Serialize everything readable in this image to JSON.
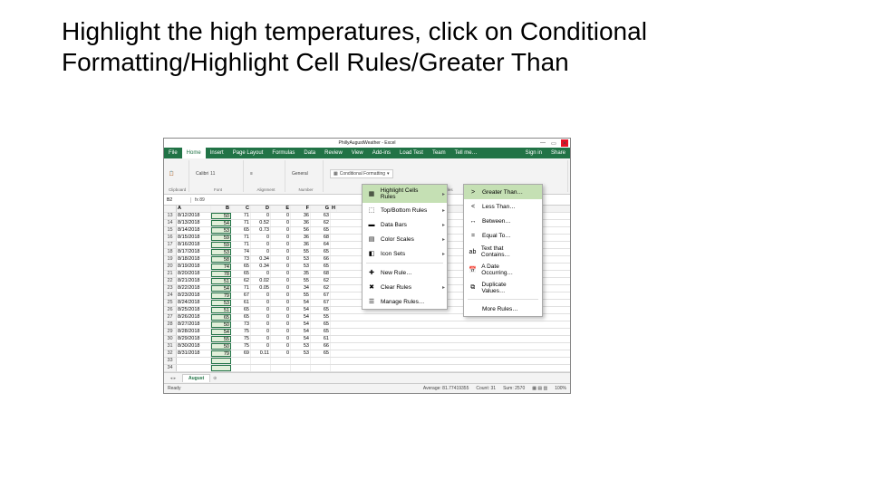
{
  "instruction": "Highlight the high temperatures, click on Conditional Formatting/Highlight Cell Rules/Greater Than",
  "titlebar": {
    "title": "PhillyAugustWeather - Excel",
    "signin": "Sign in",
    "share": "Share"
  },
  "tabs": [
    "File",
    "Home",
    "Insert",
    "Page Layout",
    "Formulas",
    "Data",
    "Review",
    "View",
    "Add-ins",
    "Load Test",
    "Team",
    "Tell me…"
  ],
  "activeTab": "Home",
  "ribbon": {
    "clipboard": "Clipboard",
    "font": "Font",
    "fontname": "Calibri",
    "fontsize": "11",
    "alignment": "Alignment",
    "number": "Number",
    "numberfmt": "General",
    "styles": "Styles",
    "cf": "Conditional Formatting"
  },
  "namebox": "B2",
  "formulabar": "fx   89",
  "cols": [
    "",
    "A",
    "B",
    "C",
    "D",
    "E",
    "F",
    "G",
    "H"
  ],
  "rows": [
    {
      "n": "13",
      "a": "8/12/2018",
      "b": "50",
      "c": "71",
      "d": "0",
      "e": "0",
      "f": "36",
      "g": "63"
    },
    {
      "n": "14",
      "a": "8/13/2018",
      "b": "54",
      "c": "71",
      "d": "0.52",
      "e": "0",
      "f": "36",
      "g": "62"
    },
    {
      "n": "15",
      "a": "8/14/2018",
      "b": "53",
      "c": "65",
      "d": "0.73",
      "e": "0",
      "f": "56",
      "g": "65"
    },
    {
      "n": "16",
      "a": "8/15/2018",
      "b": "59",
      "c": "71",
      "d": "0",
      "e": "0",
      "f": "36",
      "g": "68"
    },
    {
      "n": "17",
      "a": "8/16/2018",
      "b": "59",
      "c": "71",
      "d": "0",
      "e": "0",
      "f": "36",
      "g": "64"
    },
    {
      "n": "18",
      "a": "8/17/2018",
      "b": "53",
      "c": "74",
      "d": "0",
      "e": "0",
      "f": "55",
      "g": "65"
    },
    {
      "n": "19",
      "a": "8/18/2018",
      "b": "58",
      "c": "73",
      "d": "0.34",
      "e": "0",
      "f": "53",
      "g": "66"
    },
    {
      "n": "20",
      "a": "8/19/2018",
      "b": "74",
      "c": "65",
      "d": "0.34",
      "e": "0",
      "f": "53",
      "g": "65"
    },
    {
      "n": "21",
      "a": "8/20/2018",
      "b": "78",
      "c": "65",
      "d": "0",
      "e": "0",
      "f": "35",
      "g": "68"
    },
    {
      "n": "22",
      "a": "8/21/2018",
      "b": "51",
      "c": "62",
      "d": "0.02",
      "e": "0",
      "f": "55",
      "g": "62"
    },
    {
      "n": "23",
      "a": "8/22/2018",
      "b": "54",
      "c": "71",
      "d": "0.05",
      "e": "0",
      "f": "34",
      "g": "62"
    },
    {
      "n": "24",
      "a": "8/23/2018",
      "b": "79",
      "c": "67",
      "d": "0",
      "e": "0",
      "f": "55",
      "g": "67"
    },
    {
      "n": "25",
      "a": "8/24/2018",
      "b": "53",
      "c": "61",
      "d": "0",
      "e": "0",
      "f": "54",
      "g": "67"
    },
    {
      "n": "26",
      "a": "8/25/2018",
      "b": "51",
      "c": "65",
      "d": "0",
      "e": "0",
      "f": "54",
      "g": "65"
    },
    {
      "n": "27",
      "a": "8/26/2018",
      "b": "65",
      "c": "65",
      "d": "0",
      "e": "0",
      "f": "54",
      "g": "55"
    },
    {
      "n": "28",
      "a": "8/27/2018",
      "b": "50",
      "c": "73",
      "d": "0",
      "e": "0",
      "f": "54",
      "g": "65"
    },
    {
      "n": "29",
      "a": "8/28/2018",
      "b": "54",
      "c": "75",
      "d": "0",
      "e": "0",
      "f": "54",
      "g": "65"
    },
    {
      "n": "30",
      "a": "8/29/2018",
      "b": "55",
      "c": "75",
      "d": "0",
      "e": "0",
      "f": "54",
      "g": "61"
    },
    {
      "n": "31",
      "a": "8/30/2018",
      "b": "50",
      "c": "75",
      "d": "0",
      "e": "0",
      "f": "53",
      "g": "66"
    },
    {
      "n": "32",
      "a": "8/31/2018",
      "b": "79",
      "c": "69",
      "d": "0.11",
      "e": "0",
      "f": "53",
      "g": "65"
    },
    {
      "n": "33",
      "a": "",
      "b": "",
      "c": "",
      "d": "",
      "e": "",
      "f": "",
      "g": ""
    },
    {
      "n": "34",
      "a": "",
      "b": "",
      "c": "",
      "d": "",
      "e": "",
      "f": "",
      "g": ""
    }
  ],
  "sheet": "August",
  "status": {
    "ready": "Ready",
    "avg": "Average: 81.77419355",
    "count": "Count: 31",
    "sum": "Sum: 2570",
    "zoom": "100%"
  },
  "cf_menu": [
    {
      "icon": "▦",
      "label": "Highlight Cells Rules",
      "arrow": true,
      "hl": true
    },
    {
      "icon": "⬚",
      "label": "Top/Bottom Rules",
      "arrow": true
    },
    {
      "icon": "▬",
      "label": "Data Bars",
      "arrow": true
    },
    {
      "icon": "▤",
      "label": "Color Scales",
      "arrow": true
    },
    {
      "icon": "◧",
      "label": "Icon Sets",
      "arrow": true
    },
    {
      "sep": true
    },
    {
      "icon": "✚",
      "label": "New Rule…"
    },
    {
      "icon": "✖",
      "label": "Clear Rules",
      "arrow": true
    },
    {
      "icon": "☰",
      "label": "Manage Rules…"
    }
  ],
  "sub_menu": [
    {
      "icon": ">",
      "label": "Greater Than…",
      "hl": true
    },
    {
      "icon": "<",
      "label": "Less Than…"
    },
    {
      "icon": "↔",
      "label": "Between…"
    },
    {
      "icon": "=",
      "label": "Equal To…"
    },
    {
      "icon": "ab",
      "label": "Text that Contains…"
    },
    {
      "icon": "📅",
      "label": "A Date Occurring…"
    },
    {
      "icon": "⧉",
      "label": "Duplicate Values…"
    },
    {
      "sep": true
    },
    {
      "icon": "",
      "label": "More Rules…"
    }
  ]
}
